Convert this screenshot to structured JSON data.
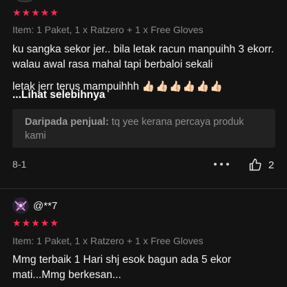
{
  "reviews": [
    {
      "rating_stars": "★★★★★",
      "rating": 5,
      "item": "Item: 1 Paket, 1 x Ratzero + 1 x Free Gloves",
      "text_1": "ku sangka sekor jer.. bila letak racun manpuihh 3 ekorr. walau awal rasa mahal tapi berbaloi sekali",
      "text_2": "letak jerr terus mampuihhh",
      "emoji": "👍🏻👍🏻👍🏻👍🏻👍🏻👍🏻",
      "see_more": "...Lihat selebihnya",
      "seller_label": "Daripada penjual:",
      "seller_reply": "tq yee kerana percaya produk kami",
      "date": "8-1",
      "likes": "2"
    },
    {
      "username": "@**7",
      "rating_stars": "★★★★★",
      "rating": 5,
      "item": "Item: 1 Paket, 1 x Ratzero + 1 x Free Gloves",
      "text_1": "Mmg terbaik 1 Hari shj esok bagun ada 5 ekor mati...Mmg berkesan..."
    }
  ],
  "icons": {
    "more": "more-icon",
    "like": "thumbs-up-icon"
  },
  "colors": {
    "background": "#131313",
    "star": "#fe2c55",
    "muted_text": "#8a8a8a",
    "seller_box": "#222222"
  }
}
